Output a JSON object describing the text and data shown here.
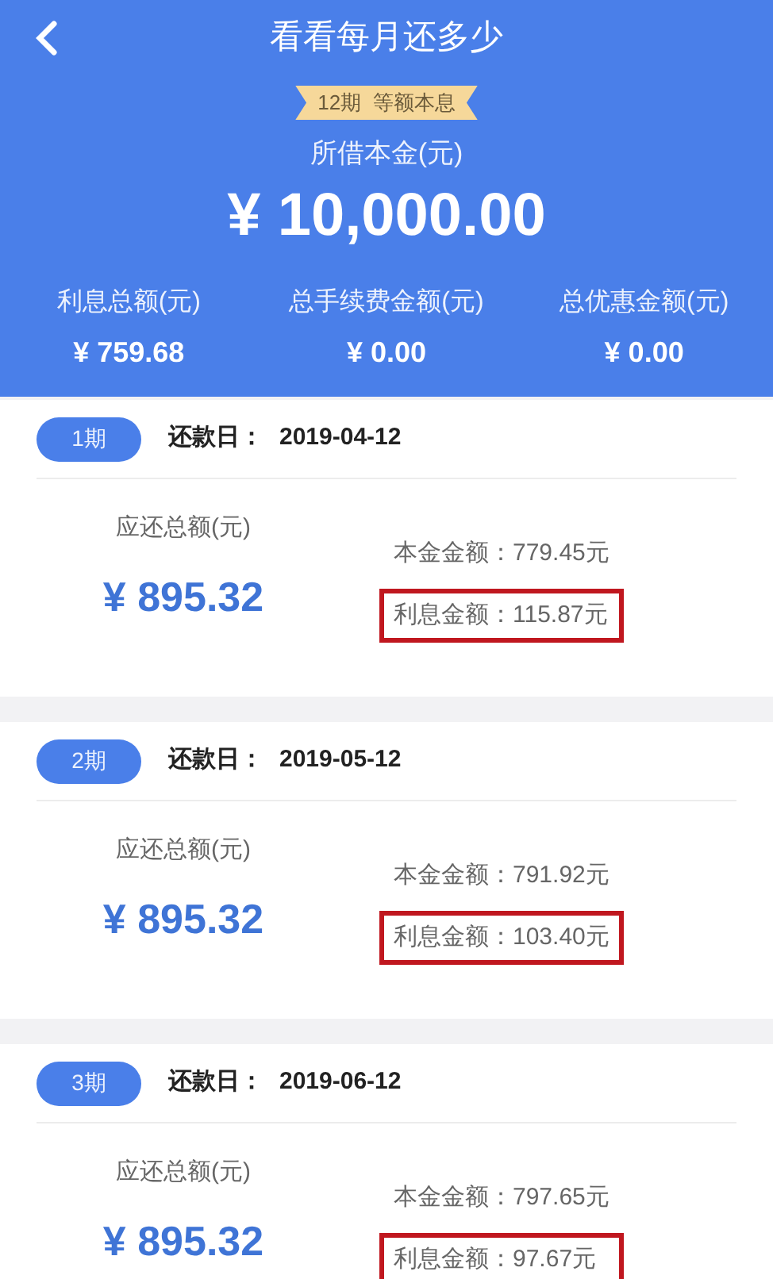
{
  "header": {
    "title": "看看每月还多少",
    "plan_badge": "12期  等额本息",
    "principal_label": "所借本金(元)",
    "principal": "¥ 10,000.00",
    "summary": [
      {
        "label": "利息总额(元)",
        "value": "¥ 759.68"
      },
      {
        "label": "总手续费金额(元)",
        "value": "¥ 0.00"
      },
      {
        "label": "总优惠金额(元)",
        "value": "¥ 0.00"
      }
    ]
  },
  "periods": [
    {
      "badge": "1期",
      "due_label": "还款日：",
      "due_date": "2019-04-12",
      "total_label": "应还总额(元)",
      "total": "¥ 895.32",
      "lines": [
        {
          "text": "本金金额：779.45元",
          "highlighted": false
        },
        {
          "text": "利息金额：115.87元",
          "highlighted": true
        }
      ]
    },
    {
      "badge": "2期",
      "due_label": "还款日：",
      "due_date": "2019-05-12",
      "total_label": "应还总额(元)",
      "total": "¥ 895.32",
      "lines": [
        {
          "text": "本金金额：791.92元",
          "highlighted": false
        },
        {
          "text": "利息金额：103.40元",
          "highlighted": true
        }
      ]
    },
    {
      "badge": "3期",
      "due_label": "还款日：",
      "due_date": "2019-06-12",
      "total_label": "应还总额(元)",
      "total": "¥ 895.32",
      "lines": [
        {
          "text": "本金金额：797.65元",
          "highlighted": false
        },
        {
          "text": "利息金额：97.67元",
          "highlighted": true
        }
      ]
    }
  ]
}
